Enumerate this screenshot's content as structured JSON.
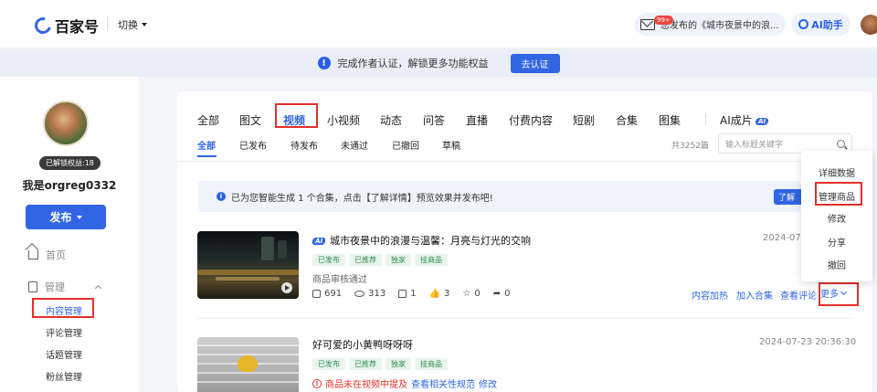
{
  "header": {
    "logo_text": "百家号",
    "switch_label": "切换",
    "notif_badge": "99+",
    "notif_text": "您发布的《城市夜景中的浪...",
    "ai_label": "AI助手"
  },
  "banner": {
    "text": "完成作者认证，解锁更多功能权益",
    "button": "去认证"
  },
  "sidebar": {
    "rights_badge": "已解锁权益:18",
    "username": "我是orgreg0332",
    "publish_label": "发布",
    "home_label": "首页",
    "manage_label": "管理",
    "sub_items": [
      "内容管理",
      "评论管理",
      "话题管理",
      "粉丝管理"
    ]
  },
  "tabs": {
    "items": [
      "全部",
      "图文",
      "视频",
      "小视频",
      "动态",
      "问答",
      "直播",
      "付费内容",
      "短剧",
      "合集",
      "图集",
      "AI成片"
    ],
    "ai_tag": "AI",
    "active": "视频"
  },
  "subtabs": {
    "items": [
      "全部",
      "已发布",
      "待发布",
      "未通过",
      "已撤回",
      "草稿"
    ],
    "active": "全部"
  },
  "total_count": "共3252篇",
  "search": {
    "placeholder": "输入标题关键字"
  },
  "notice": {
    "text": "已为您智能生成 1 个合集，点击【了解详情】预览效果并发布吧!",
    "button": "了解"
  },
  "items": [
    {
      "ai_chip": "AI",
      "title": "城市夜景中的浪漫与温馨：月亮与灯光的交响",
      "tags": [
        "已发布",
        "已推荐",
        "独家",
        "挂商品"
      ],
      "status_text": "商品审核通过",
      "stats": {
        "plays": "691",
        "views": "313",
        "comments": "1",
        "likes": "3",
        "favs": "0",
        "shares": "0"
      },
      "date": "2024-07-",
      "actions": [
        "内容加热",
        "加入合集",
        "查看评论"
      ],
      "more_label": "更多"
    },
    {
      "title": "好可爱的小黄鸭呀呀呀",
      "tags": [
        "已发布",
        "已推荐",
        "独家",
        "挂商品"
      ],
      "warn_text": "商品未在视频中提及",
      "warn_link": "查看相关性规范",
      "warn_edit": "修改",
      "date": "2024-07-23 20:36:30"
    }
  ],
  "more_menu": [
    "详细数据",
    "管理商品",
    "修改",
    "分享",
    "撤回"
  ],
  "colors": {
    "accent": "#3165e3",
    "highlight": "#e0302c",
    "tag_green": "#2f8a4b"
  }
}
